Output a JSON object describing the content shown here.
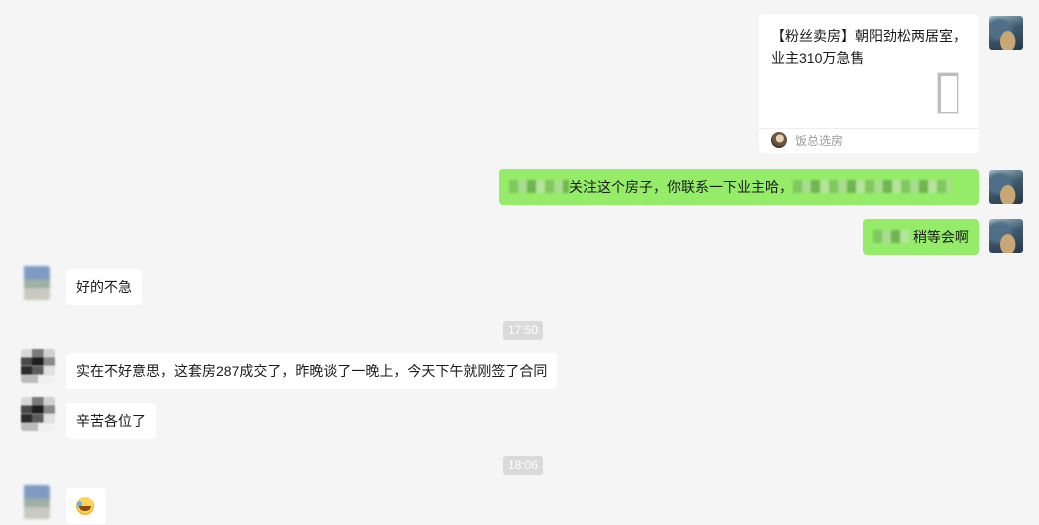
{
  "card": {
    "title": "【粉丝卖房】朝阳劲松两居室，业主310万急售",
    "source": "饭总选房",
    "thumb_icon": "floor-plan-thumbnail",
    "source_icon": "source-avatar-icon"
  },
  "messages": [
    {
      "side": "out",
      "text_before": "",
      "text_middle": "关注这个房子，你联系一下业主哈，",
      "text_after": ""
    },
    {
      "side": "out",
      "text_after": "稍等会啊"
    },
    {
      "side": "in",
      "text": "好的不急"
    },
    {
      "side": "in",
      "text": "实在不好意思，这套房287成交了，昨晚谈了一晚上，今天下午就刚签了合同"
    },
    {
      "side": "in",
      "text": "辛苦各位了"
    },
    {
      "side": "in",
      "emoji": "laughing-tears-emoji"
    }
  ],
  "timestamps": [
    "17:50",
    "18:06"
  ],
  "colors": {
    "background": "#f5f5f5",
    "outgoing_bubble": "#95ec69",
    "incoming_bubble": "#ffffff",
    "timestamp_bg": "#dadada"
  }
}
